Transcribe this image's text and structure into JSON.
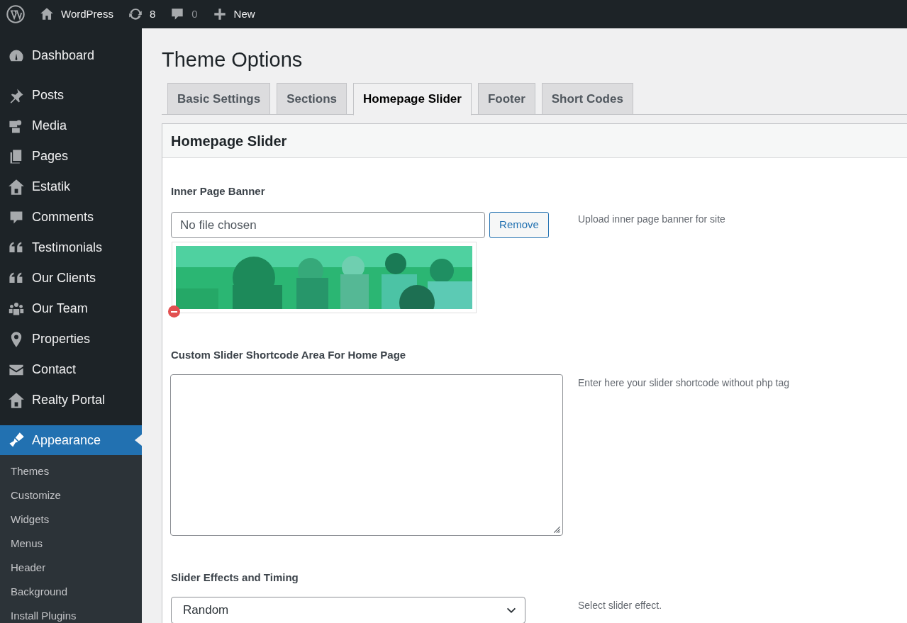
{
  "admin_bar": {
    "items": [
      {
        "kind": "logo"
      },
      {
        "kind": "home",
        "label": "WordPress"
      },
      {
        "kind": "updates",
        "label": "8"
      },
      {
        "kind": "comments",
        "label": "0"
      },
      {
        "kind": "new",
        "label": "New"
      }
    ]
  },
  "sidebar": {
    "items": [
      {
        "label": "Dashboard",
        "selected": false
      },
      {
        "label": "Posts",
        "selected": false
      },
      {
        "label": "Media",
        "selected": false
      },
      {
        "label": "Pages",
        "selected": false
      },
      {
        "label": "Estatik",
        "selected": false
      },
      {
        "label": "Comments",
        "selected": false
      },
      {
        "label": "Testimonials",
        "selected": false
      },
      {
        "label": "Our Clients",
        "selected": false
      },
      {
        "label": "Our Team",
        "selected": false
      },
      {
        "label": "Properties",
        "selected": false
      },
      {
        "label": "Contact",
        "selected": false
      },
      {
        "label": "Realty Portal",
        "selected": false
      },
      {
        "label": "Appearance",
        "selected": true
      }
    ],
    "submenu": [
      "Themes",
      "Customize",
      "Widgets",
      "Menus",
      "Header",
      "Background",
      "Install Plugins"
    ]
  },
  "page_title": "Theme Options",
  "tabs": [
    {
      "label": "Basic Settings",
      "selected": false
    },
    {
      "label": "Sections",
      "selected": false
    },
    {
      "label": "Homepage Slider",
      "selected": true
    },
    {
      "label": "Footer",
      "selected": false
    },
    {
      "label": "Short Codes",
      "selected": false
    }
  ],
  "panel": {
    "title": "Homepage Slider",
    "fields": [
      {
        "kind": "file",
        "label": "Inner Page Banner",
        "value": "No file chosen",
        "button": "Remove",
        "description": "Upload inner page banner for site"
      },
      {
        "kind": "textarea",
        "label": "Custom Slider Shortcode Area For Home Page",
        "description": "Enter here your slider shortcode without php tag"
      },
      {
        "kind": "select",
        "label": "Slider Effects and Timing",
        "value": "Random",
        "description": "Select slider effect."
      }
    ]
  }
}
